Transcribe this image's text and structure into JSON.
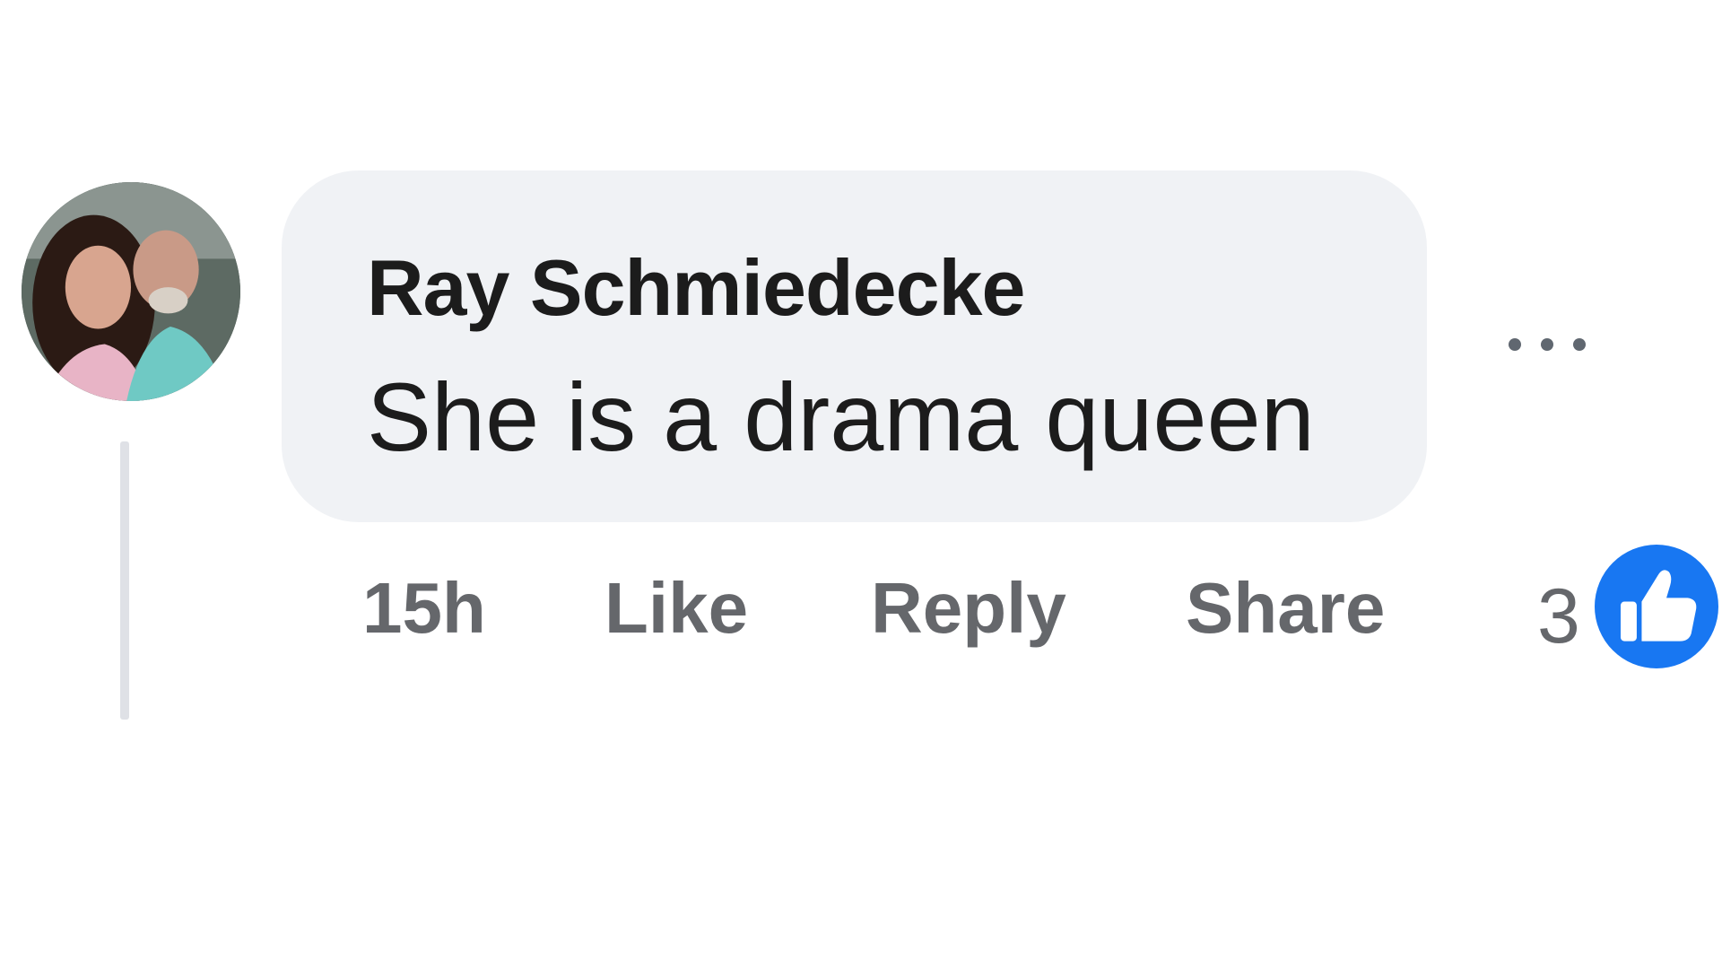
{
  "comment": {
    "author": "Ray Schmiedecke",
    "text": "She is a drama queen",
    "timestamp": "15h",
    "actions": {
      "like": "Like",
      "reply": "Reply",
      "share": "Share"
    },
    "reactions": {
      "count": "3",
      "icon": "thumbs-up-icon",
      "color": "#1877f2"
    },
    "more_icon": "more-options-icon"
  },
  "colors": {
    "bubble": "#f0f2f5",
    "text": "#1c1c1c",
    "secondary_text": "#65676b",
    "accent": "#1877f2"
  }
}
